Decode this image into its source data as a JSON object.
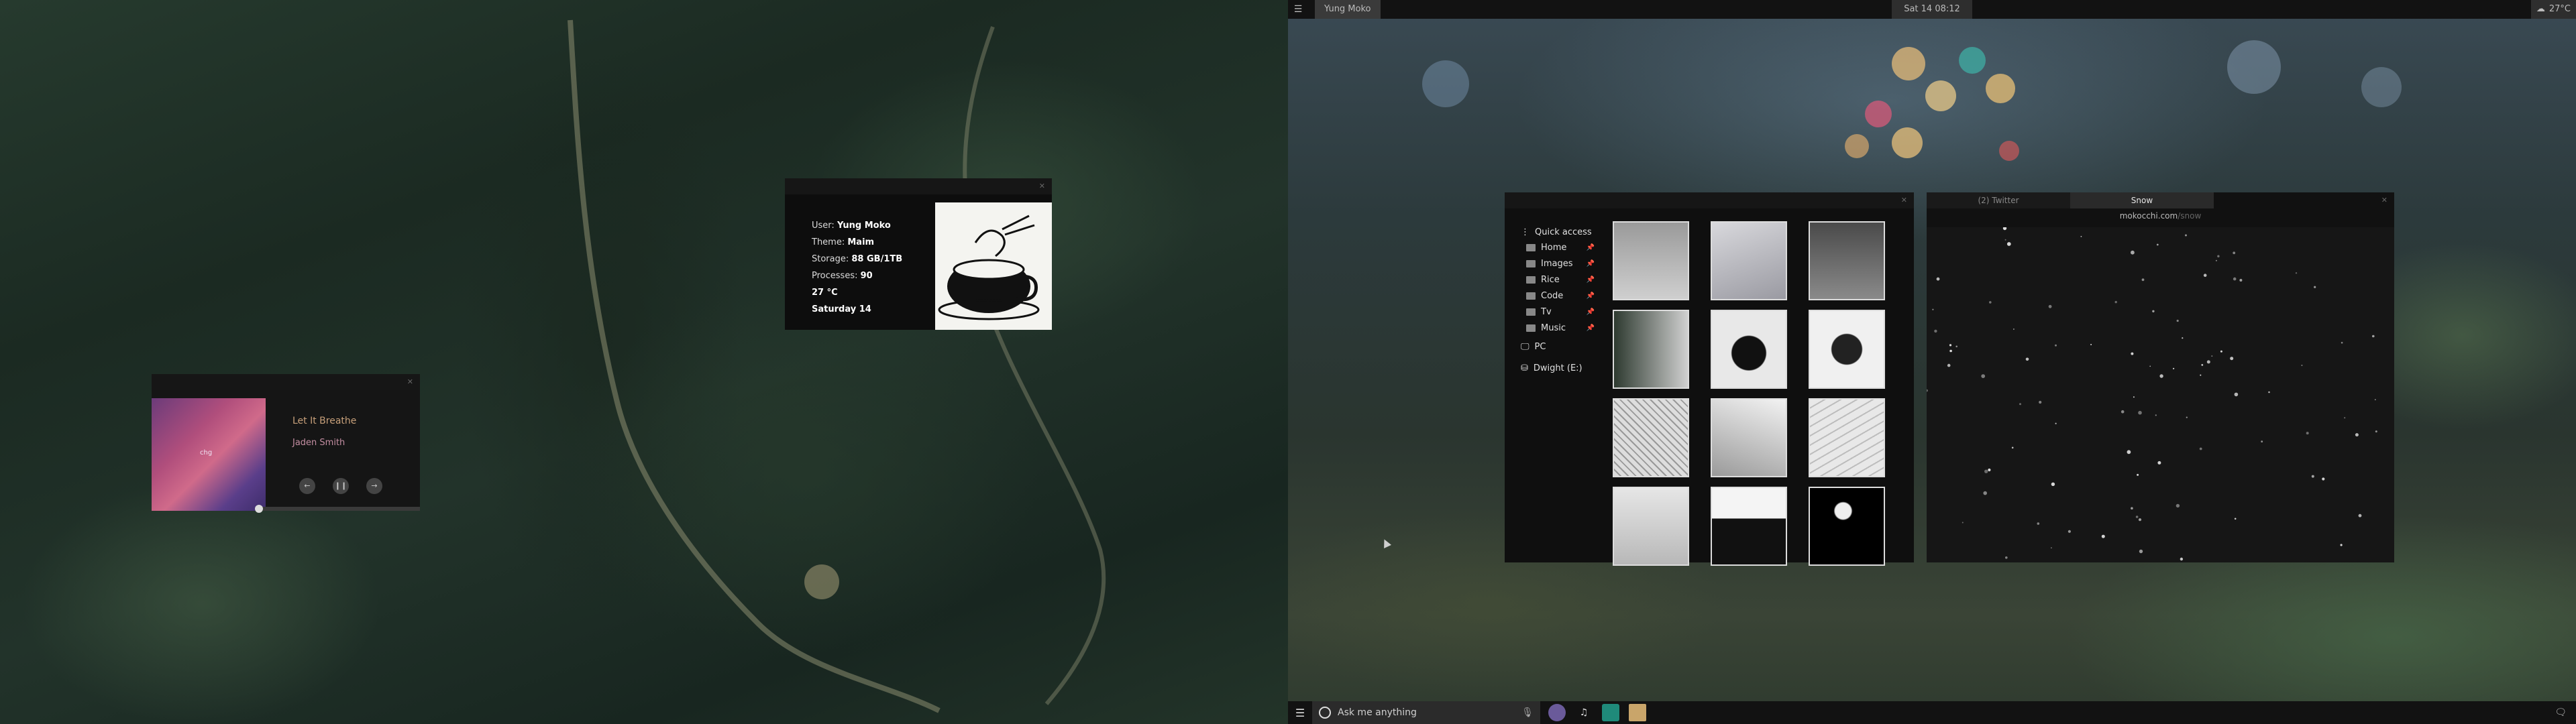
{
  "topbar": {
    "active_window": "Yung Moko",
    "clock": "Sat 14 08:12",
    "weather_temp": "27°C"
  },
  "taskbar": {
    "search_placeholder": "Ask me anything"
  },
  "music": {
    "title": "Let It Breathe",
    "artist": "Jaden Smith",
    "art_caption": "chg",
    "progress": 0.0
  },
  "sysinfo": {
    "user_label": "User:",
    "user": "Yung Moko",
    "theme_label": "Theme:",
    "theme": "Maim",
    "storage_label": "Storage:",
    "storage": "88 GB/1TB",
    "processes_label": "Processes:",
    "processes": "90",
    "temperature": "27 °C",
    "date": "Saturday 14"
  },
  "files": {
    "quick_access": "Quick access",
    "folders": [
      "Home",
      "Images",
      "Rice",
      "Code",
      "Tv",
      "Music"
    ],
    "pc": "PC",
    "drive": "Dwight (E:)"
  },
  "browser": {
    "tabs": [
      "(2) Twitter",
      "Snow"
    ],
    "url_host": "mokocchi.com",
    "url_path": "/snow"
  },
  "colors": {
    "bar": "#121212",
    "accent_song": "#c7a07a",
    "accent_artist": "#c48ea2"
  }
}
